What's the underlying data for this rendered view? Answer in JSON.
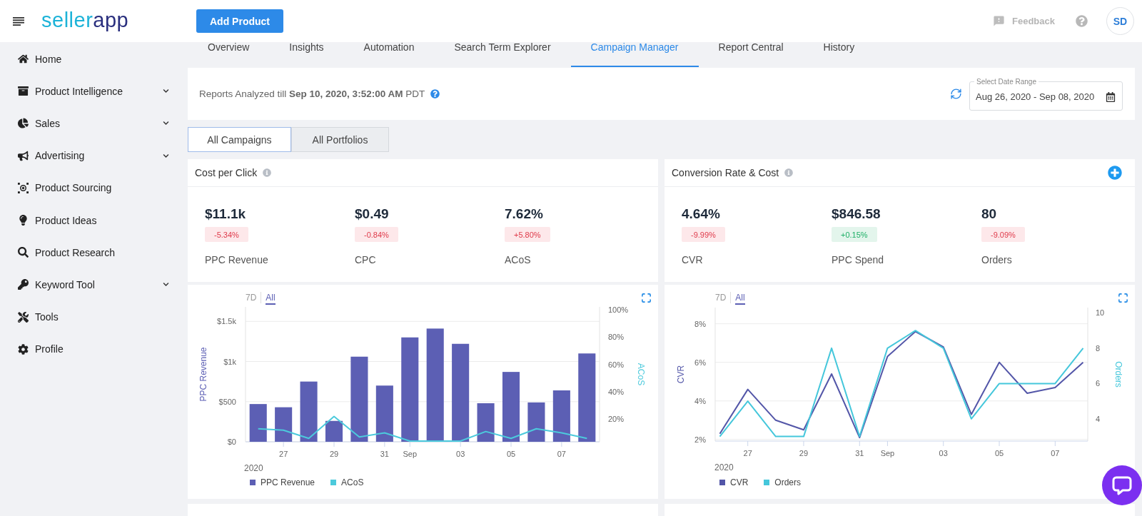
{
  "header": {
    "logo": {
      "primary": "seller",
      "secondary": "app"
    },
    "add_button": "Add Product",
    "feedback": "Feedback",
    "avatar": "SD"
  },
  "sidebar": {
    "items": [
      {
        "label": "Home",
        "kind": "link"
      },
      {
        "label": "Product Intelligence",
        "kind": "group"
      },
      {
        "label": "Sales",
        "kind": "group"
      },
      {
        "label": "Advertising",
        "kind": "group"
      },
      {
        "label": "Product Sourcing",
        "kind": "link"
      },
      {
        "label": "Product Ideas",
        "kind": "link"
      },
      {
        "label": "Product Research",
        "kind": "link"
      },
      {
        "label": "Keyword Tool",
        "kind": "group"
      },
      {
        "label": "Tools",
        "kind": "link"
      },
      {
        "label": "Profile",
        "kind": "link"
      }
    ]
  },
  "tabs": [
    {
      "label": "Overview",
      "selected": false
    },
    {
      "label": "Insights",
      "selected": false
    },
    {
      "label": "Automation",
      "selected": false
    },
    {
      "label": "Search Term Explorer",
      "selected": false
    },
    {
      "label": "Campaign Manager",
      "selected": true
    },
    {
      "label": "Report Central",
      "selected": false
    },
    {
      "label": "History",
      "selected": false
    }
  ],
  "report_bar": {
    "status": "Reports Analyzed till **Sep 10, 2020, 3:52:00 AM** PDT",
    "date_range": {
      "label": "Select Date Range",
      "value": "Aug 26, 2020 - Sep 08, 2020"
    }
  },
  "view_tabs": [
    {
      "label": "All Campaigns",
      "selected": true
    },
    {
      "label": "All Portfolios",
      "selected": false
    }
  ],
  "kpi_cards": [
    {
      "title": "Cost per Click",
      "add_button": false,
      "metrics": [
        {
          "value": "$11.1k",
          "change": "-5.34%",
          "color": "#fde8ea",
          "label": "PPC Revenue"
        },
        {
          "value": "$0.49",
          "change": "-0.84%",
          "color": "#fde8ea",
          "label": "CPC"
        },
        {
          "value": "7.62%",
          "change": "+5.80%",
          "color": "#fde8ea",
          "label": "ACoS"
        }
      ]
    },
    {
      "title": "Conversion Rate & Cost",
      "add_button": true,
      "metrics": [
        {
          "value": "4.64%",
          "change": "-9.99%",
          "color": "#fde8ea",
          "label": "CVR"
        },
        {
          "value": "$846.58",
          "change": "+0.15%",
          "color": "#e3f5ec",
          "label": "PPC Spend"
        },
        {
          "value": "80",
          "change": "-9.09%",
          "color": "#fde8ea",
          "label": "Orders"
        }
      ]
    }
  ],
  "charts": [
    {
      "range_options": [
        {
          "label": "7D",
          "selected": false
        },
        {
          "label": "All",
          "selected": true
        }
      ],
      "chart_data": {
        "type": "bar",
        "x": [
          "2020-08-26",
          "2020-08-27",
          "2020-08-28",
          "2020-08-29",
          "2020-08-30",
          "2020-08-31",
          "2020-09-01",
          "2020-09-02",
          "2020-09-03",
          "2020-09-04",
          "2020-09-05",
          "2020-09-06",
          "2020-09-07",
          "2020-09-08"
        ],
        "xlim": [
          "2020-08-25T12:00",
          "2020-09-08T12:00"
        ],
        "xticks": [
          {
            "value": "2020-08-27",
            "label": "27"
          },
          {
            "value": "2020-08-29",
            "label": "29"
          },
          {
            "value": "2020-08-31",
            "label": "31"
          },
          {
            "value": "2020-09-01",
            "label": "Sep"
          },
          {
            "value": "2020-09-03",
            "label": "03"
          },
          {
            "value": "2020-09-05",
            "label": "05"
          },
          {
            "value": "2020-09-07",
            "label": "07"
          }
        ],
        "xlabel": "2020",
        "ylabel": "PPC Revenue",
        "y2label": "ACoS",
        "ylim": [
          0,
          1680
        ],
        "y2lim": [
          3.5,
          102
        ],
        "yticks": [
          {
            "value": 0,
            "label": "$0"
          },
          {
            "value": 500,
            "label": "$500"
          },
          {
            "value": 1000,
            "label": "$1k"
          },
          {
            "value": 1500,
            "label": "$1.5k"
          }
        ],
        "y2ticks": [
          {
            "value": 20,
            "label": "20%"
          },
          {
            "value": 40,
            "label": "40%"
          },
          {
            "value": 60,
            "label": "60%"
          },
          {
            "value": 80,
            "label": "80%"
          },
          {
            "value": 100,
            "label": "100%"
          }
        ],
        "grid": true,
        "series": [
          {
            "name": "PPC Revenue",
            "color": "#5c5fb4",
            "type": "bar",
            "values": [
              470,
              430,
              750,
              260,
              1060,
              700,
              1300,
              1410,
              1220,
              480,
              870,
              490,
              640,
              1100
            ]
          },
          {
            "name": "ACoS",
            "color": "#4ccadc",
            "type": "line",
            "axis": "y2",
            "values": [
              13,
              12,
              6,
              22,
              7,
              10,
              4,
              4,
              4,
              11,
              6,
              13,
              10,
              6
            ]
          }
        ]
      }
    },
    {
      "range_options": [
        {
          "label": "7D",
          "selected": false
        },
        {
          "label": "All",
          "selected": true
        }
      ],
      "chart_data": {
        "type": "line",
        "x": [
          "2020-08-26",
          "2020-08-27",
          "2020-08-28",
          "2020-08-29",
          "2020-08-30",
          "2020-08-31",
          "2020-09-01",
          "2020-09-02",
          "2020-09-03",
          "2020-09-04",
          "2020-09-05",
          "2020-09-06",
          "2020-09-07",
          "2020-09-08"
        ],
        "xlim": [
          "2020-08-25T20:00",
          "2020-09-08T04:00"
        ],
        "xticks": [
          {
            "value": "2020-08-27",
            "label": "27"
          },
          {
            "value": "2020-08-29",
            "label": "29"
          },
          {
            "value": "2020-08-31",
            "label": "31"
          },
          {
            "value": "2020-09-01",
            "label": "Sep"
          },
          {
            "value": "2020-09-03",
            "label": "03"
          },
          {
            "value": "2020-09-05",
            "label": "05"
          },
          {
            "value": "2020-09-07",
            "label": "07"
          }
        ],
        "xlabel": "2020",
        "ylabel": "CVR",
        "y2label": "Orders",
        "ylim": [
          1.92,
          8.84
        ],
        "y2lim": [
          2.74,
          10.3
        ],
        "yticks": [
          {
            "value": 2,
            "label": "2%"
          },
          {
            "value": 4,
            "label": "4%"
          },
          {
            "value": 6,
            "label": "6%"
          },
          {
            "value": 8,
            "label": "8%"
          }
        ],
        "y2ticks": [
          {
            "value": 4,
            "label": "4"
          },
          {
            "value": 6,
            "label": "6"
          },
          {
            "value": 8,
            "label": "8"
          },
          {
            "value": 10,
            "label": "10"
          }
        ],
        "grid": true,
        "series": [
          {
            "name": "CVR",
            "color": "#5356a8",
            "type": "line",
            "values": [
              2.3,
              4.6,
              3.0,
              2.5,
              5.4,
              2.1,
              6.3,
              7.6,
              6.8,
              3.3,
              6.0,
              4.4,
              4.7,
              6.0
            ]
          },
          {
            "name": "Orders",
            "color": "#45c7db",
            "type": "line",
            "axis": "y2",
            "values": [
              3,
              5,
              3,
              3,
              8,
              3,
              8,
              9,
              8,
              4,
              6,
              6,
              6,
              8
            ]
          }
        ]
      }
    }
  ]
}
